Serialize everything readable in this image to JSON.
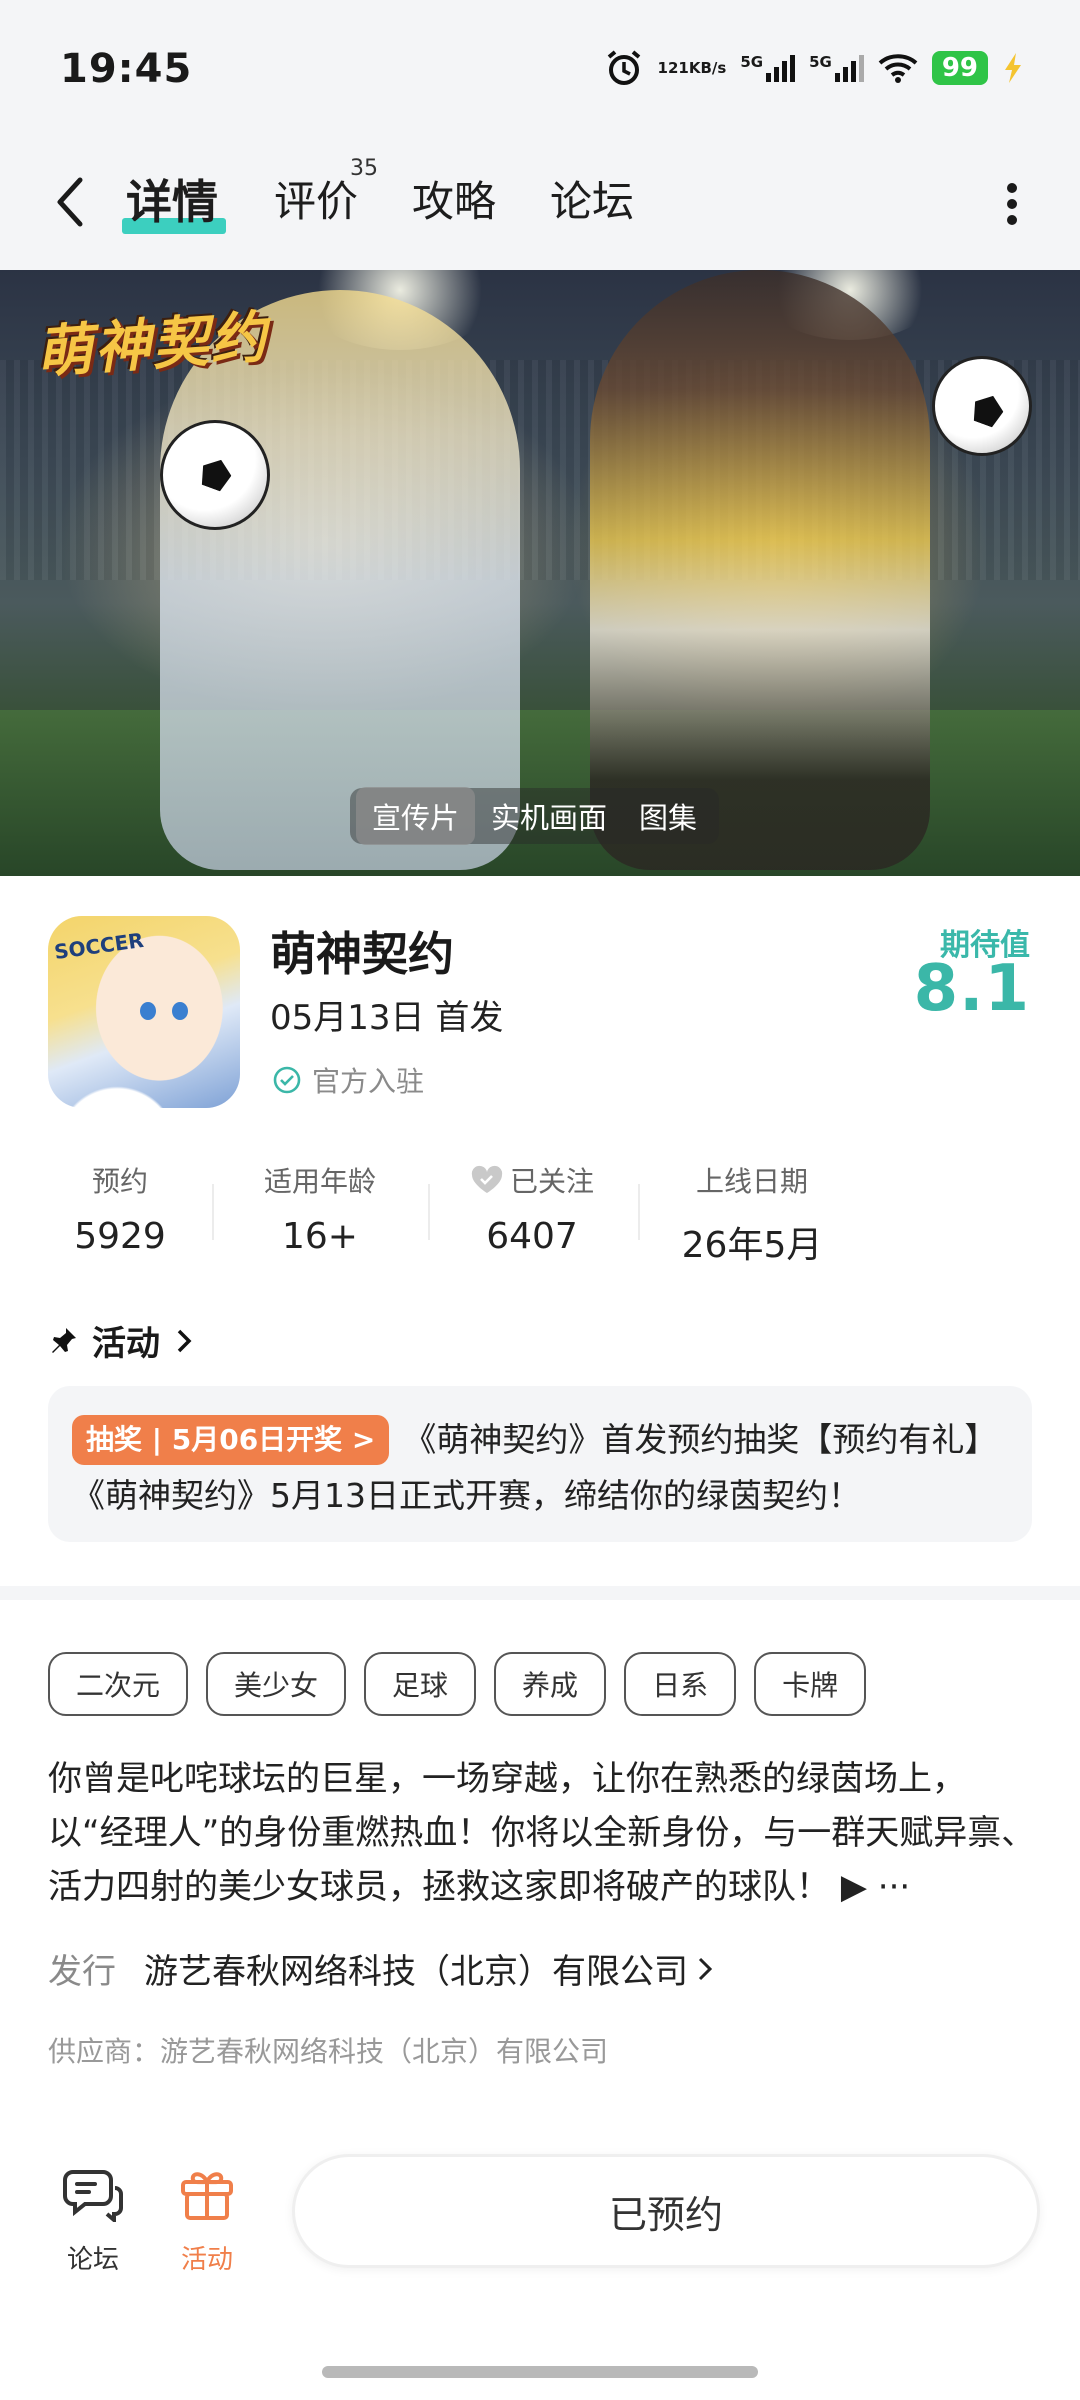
{
  "status_bar": {
    "time": "19:45",
    "net_speed_value": "121",
    "net_speed_unit": "KB/s",
    "sim1": "5G",
    "sim2": "5G",
    "battery": "99",
    "icons": [
      "alarm-icon",
      "signal-icon",
      "wifi-icon",
      "battery-icon",
      "charging-icon"
    ]
  },
  "nav": {
    "tabs": [
      {
        "label": "详情",
        "active": true
      },
      {
        "label": "评价",
        "badge": "35"
      },
      {
        "label": "攻略"
      },
      {
        "label": "论坛"
      }
    ],
    "accent_color": "#3ccfbf"
  },
  "banner": {
    "logo_text": "萌神契约",
    "media_tabs": [
      "宣传片",
      "实机画面",
      "图集"
    ],
    "selected_media_tab": "宣传片"
  },
  "game": {
    "title": "萌神契约",
    "release": "05月13日 首发",
    "official_label": "官方入驻",
    "expect_label": "期待值",
    "expect_value": "8.1",
    "icon_text": "SOCCER"
  },
  "stats": [
    {
      "label": "预约",
      "value": "5929"
    },
    {
      "label": "适用年龄",
      "value": "16+"
    },
    {
      "label": "已关注",
      "value": "6407",
      "icon": "heart-icon"
    },
    {
      "label": "上线日期",
      "value": "26年5月"
    }
  ],
  "activity": {
    "heading": "活动",
    "tag": "抽奖 | 5月06日开奖 >",
    "text": "《萌神契约》首发预约抽奖【预约有礼】《萌神契约》5月13日正式开赛，缔结你的绿茵契约！"
  },
  "tags": [
    "二次元",
    "美少女",
    "足球",
    "养成",
    "日系",
    "卡牌"
  ],
  "description": {
    "text": "你曾是叱咤球坛的巨星，一场穿越，让你在熟悉的绿茵场上，以“经理人”的身份重燃热血！你将以全新身份，与一群天赋异禀、活力四射的美少女球员，拯救这家即将破产的球队！",
    "more": "▶ ···"
  },
  "publisher": {
    "label": "发行",
    "name": "游艺春秋网络科技（北京）有限公司"
  },
  "supplier": "供应商：游艺春秋网络科技（北京）有限公司",
  "bottom_bar": {
    "forum_label": "论坛",
    "activity_label": "活动",
    "reserve_label": "已预约",
    "activity_color": "#f07f4a"
  }
}
